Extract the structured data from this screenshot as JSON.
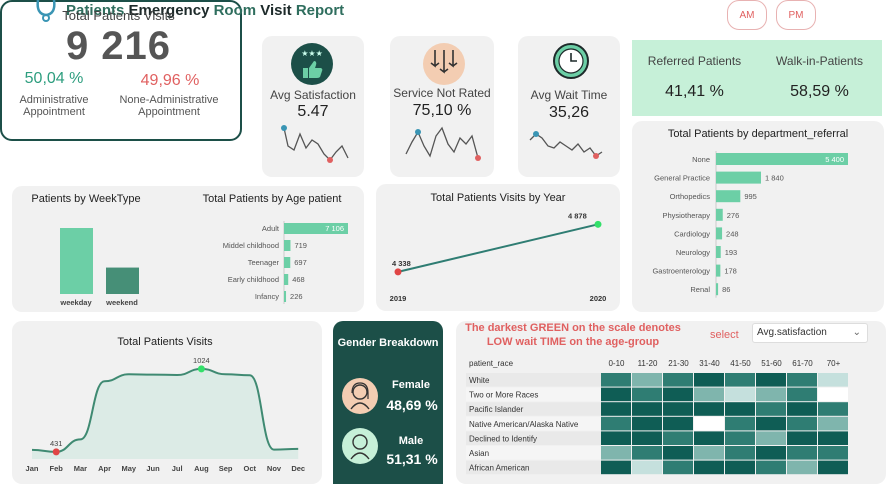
{
  "header": {
    "title_part1": "Patients",
    "title_part2": "Emergency",
    "title_part3": "Room",
    "title_part4": "Visit",
    "title_part5": "Report",
    "am_label": "AM",
    "pm_label": "PM"
  },
  "total_card": {
    "title": "Total Patients Visits",
    "value": "9 216",
    "admin_pct": "50,04 %",
    "admin_label_1": "Administrative",
    "admin_label_2": "Appointment",
    "nonadmin_pct": "49,96 %",
    "nonadmin_label_1": "None-Administrative",
    "nonadmin_label_2": "Appointment"
  },
  "kpis": {
    "satisfaction": {
      "label": "Avg Satisfaction",
      "value": "5.47"
    },
    "not_rated": {
      "label": "Service Not Rated",
      "value": "75,10 %"
    },
    "wait": {
      "label": "Avg Wait Time",
      "value": "35,26"
    }
  },
  "referral_card": {
    "referred_label": "Referred Patients",
    "referred_value": "41,41 %",
    "walkin_label": "Walk-in-Patients",
    "walkin_value": "58,59 %"
  },
  "gender": {
    "title": "Gender Breakdown",
    "female_label": "Female",
    "female_value": "48,69 %",
    "male_label": "Male",
    "male_value": "51,31 %"
  },
  "heatmap": {
    "note_line1": "The darkest GREEN on the scale denotes",
    "note_line2": "LOW wait TIME on the age-group",
    "select_label": "select",
    "select_value": "Avg.satisfaction",
    "row_header": "patient_race",
    "columns": [
      "0-10",
      "11-20",
      "21-30",
      "31-40",
      "41-50",
      "51-60",
      "61-70",
      "70+"
    ],
    "rows": [
      "White",
      "Two or More Races",
      "Pacific Islander",
      "Native American/Alaska Native",
      "Declined to Identify",
      "Asian",
      "African American"
    ],
    "levels": [
      [
        3,
        2,
        3,
        4,
        3,
        4,
        3,
        1
      ],
      [
        4,
        3,
        4,
        2,
        1,
        2,
        3,
        0
      ],
      [
        4,
        4,
        4,
        4,
        4,
        3,
        4,
        3
      ],
      [
        3,
        4,
        4,
        0,
        3,
        4,
        3,
        2
      ],
      [
        4,
        4,
        3,
        4,
        3,
        2,
        4,
        4
      ],
      [
        2,
        3,
        4,
        2,
        3,
        4,
        3,
        3
      ],
      [
        4,
        1,
        3,
        4,
        4,
        3,
        2,
        4
      ]
    ],
    "palette": [
      "#ffffff",
      "#c5e0dd",
      "#7fb5ad",
      "#2f7d73",
      "#0f5d55"
    ]
  },
  "chart_data": [
    {
      "type": "bar",
      "title": "Total Patients by department_referral",
      "categories": [
        "None",
        "General Practice",
        "Orthopedics",
        "Physiotherapy",
        "Cardiology",
        "Neurology",
        "Gastroenterology",
        "Renal"
      ],
      "values": [
        5400,
        1840,
        995,
        276,
        248,
        193,
        178,
        86
      ],
      "labels": [
        "5 400",
        "1 840",
        "995",
        "276",
        "248",
        "193",
        "178",
        "86"
      ],
      "orientation": "horizontal",
      "color": "#6ccfa6"
    },
    {
      "type": "bar",
      "title": "Patients by WeekType",
      "categories": [
        "weekday",
        "weekend"
      ],
      "values": [
        6580,
        2636
      ],
      "colors": [
        "#6ccfa6",
        "#468f77"
      ]
    },
    {
      "type": "bar",
      "title": "Total Patients by Age patient",
      "categories": [
        "Adult",
        "Middel childhood",
        "Teenager",
        "Early childhood",
        "Infancy"
      ],
      "values": [
        7106,
        719,
        697,
        468,
        226
      ],
      "labels": [
        "7 106",
        "719",
        "697",
        "468",
        "226"
      ],
      "orientation": "horizontal",
      "color": "#6ccfa6"
    },
    {
      "type": "line",
      "title": "Total Patients Visits by Year",
      "x": [
        "2019",
        "2020"
      ],
      "values": [
        4338,
        4878
      ],
      "labels": [
        "4 338",
        "4 878"
      ]
    },
    {
      "type": "area",
      "title": "Total Patients Visits",
      "x": [
        "Jan",
        "Feb",
        "Mar",
        "Apr",
        "May",
        "Jun",
        "Jul",
        "Aug",
        "Sep",
        "Oct",
        "Nov",
        "Dec"
      ],
      "values": [
        445,
        431,
        520,
        935,
        985,
        983,
        980,
        1024,
        985,
        978,
        447,
        452
      ],
      "min_label": "431",
      "max_label": "1024",
      "ylim": [
        380,
        1080
      ]
    }
  ],
  "colors": {
    "accent": "#6ccfa6",
    "dark": "#1c4f48",
    "red": "#e06060"
  }
}
